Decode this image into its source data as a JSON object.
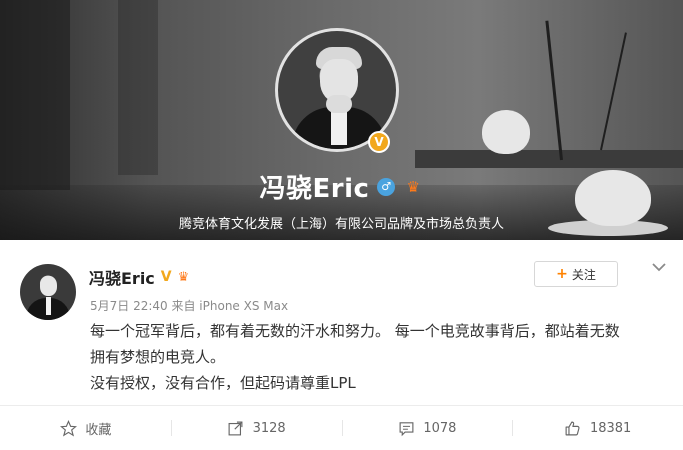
{
  "profile": {
    "name": "冯骁Eric",
    "description": "腾竞体育文化发展（上海）有限公司品牌及市场总负责人",
    "verified_badge": "V",
    "gender_icon": "male-icon",
    "crown_icon": "crown-icon"
  },
  "post": {
    "author": "冯骁Eric",
    "verified_badge": "V",
    "meta": "5月7日 22:40 来自 iPhone XS Max",
    "follow_label": "关注",
    "lines": [
      "每一个冠军背后，都有着无数的汗水和努力。 每一个电竞故事背后，都站着无数",
      "拥有梦想的电竞人。",
      "没有授权，没有合作，但起码请尊重LPL"
    ]
  },
  "actions": {
    "favorite_label": "收藏",
    "repost_count": "3128",
    "comment_count": "1078",
    "like_count": "18381"
  },
  "colors": {
    "accent": "#ff8200",
    "verified": "#f2a81d",
    "text": "#333333",
    "meta": "#8a8a8a"
  }
}
